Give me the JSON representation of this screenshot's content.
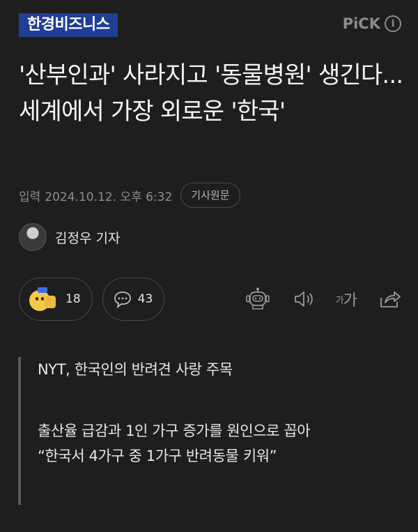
{
  "header": {
    "press_logo": "한경비즈니스",
    "pick_label": "PiCK",
    "info_glyph": "i"
  },
  "article": {
    "headline": "'산부인과' 사라지고 '동물병원' 생긴다...세계에서 가장 외로운 '한국'",
    "date_label": "입력",
    "date_value": "2024.10.12. 오후 6:32",
    "original_button": "기사원문",
    "reporter": "김정우 기자"
  },
  "actions": {
    "reaction_count": "18",
    "comment_count": "43",
    "font_size_small": "가",
    "font_size_big": "가"
  },
  "summary": {
    "line1": "NYT, 한국인의 반려견 사랑 주목",
    "line2": "출산율 급감과 1인 가구 증가를 원인으로 꼽아",
    "line3": "“한국서 4가구 중 1가구 반려동물 키워”"
  },
  "colors": {
    "background": "#1e1e1e",
    "press_logo_bg": "#1f3f95",
    "muted_text": "#8e8e8e"
  }
}
